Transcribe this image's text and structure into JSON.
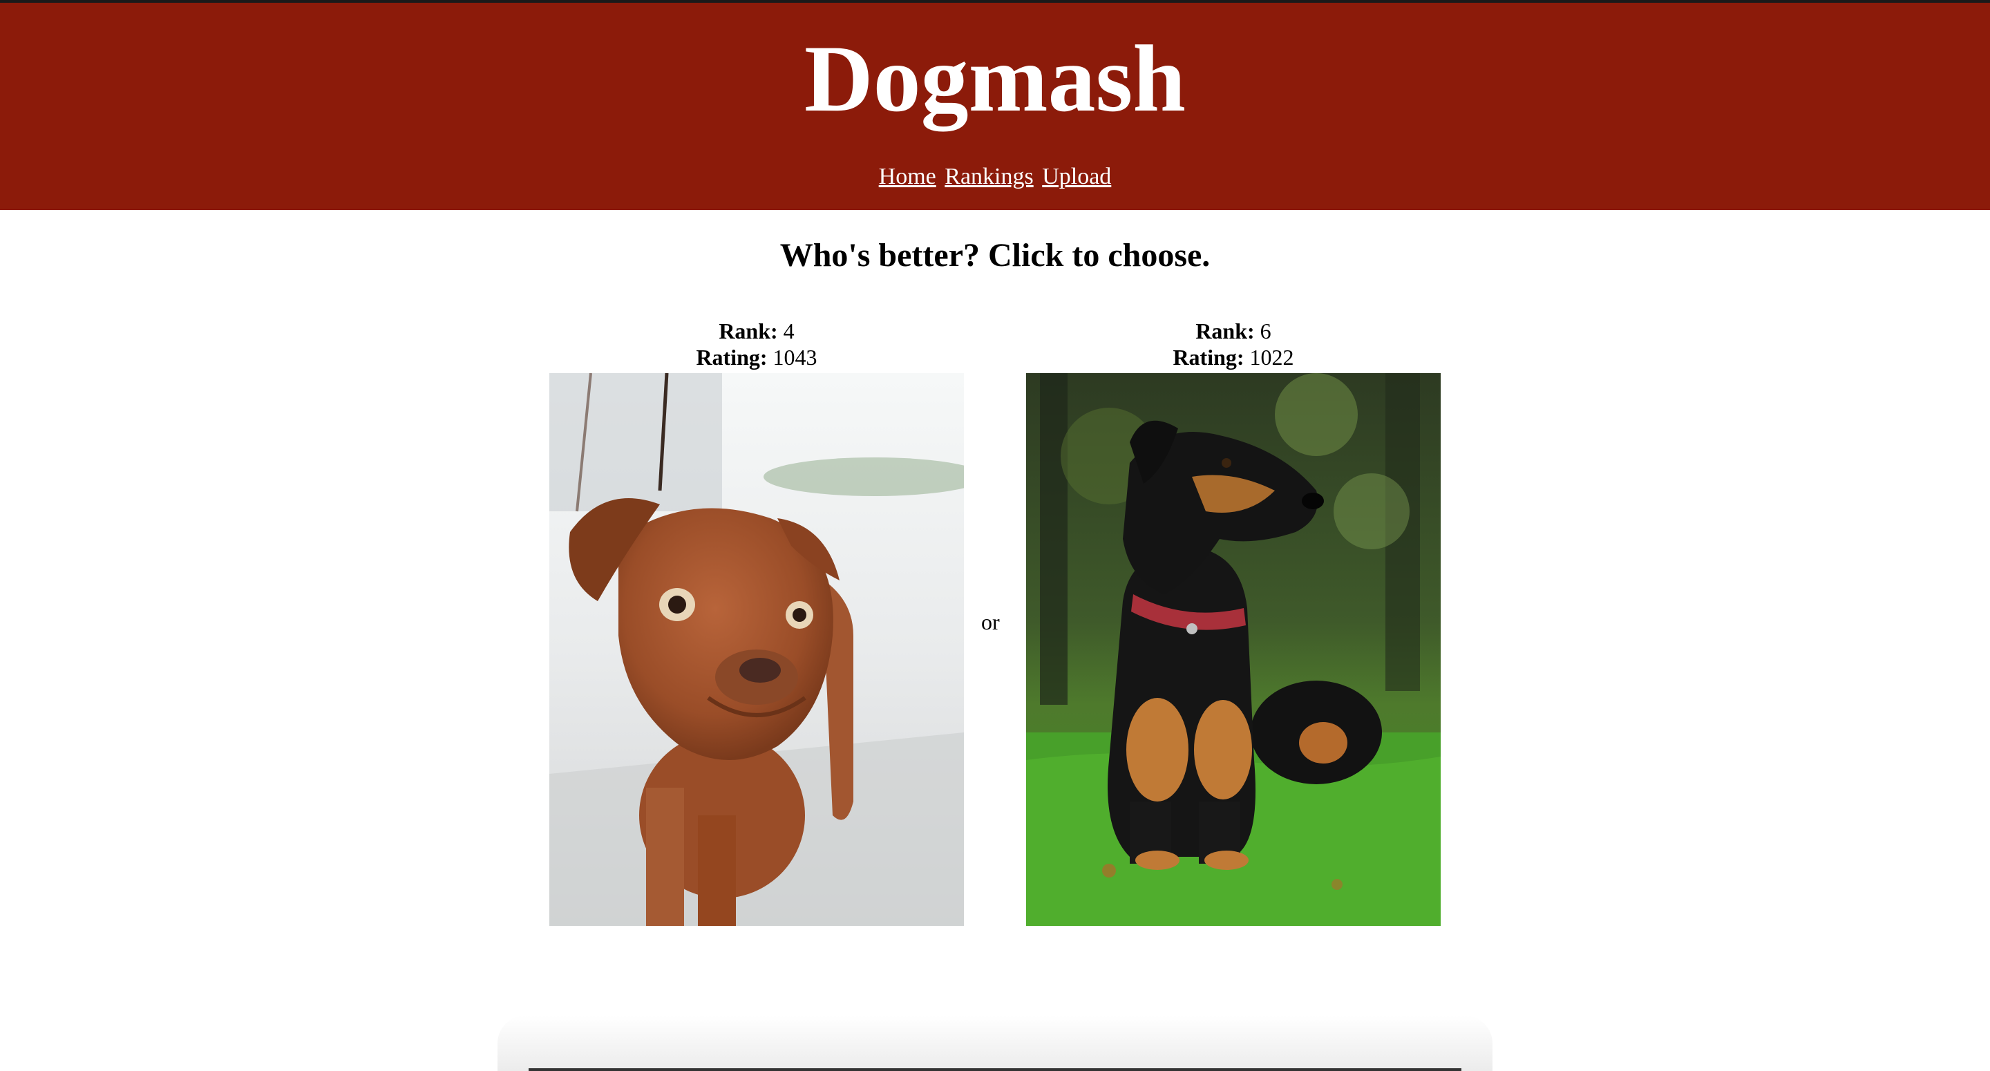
{
  "header": {
    "title": "Dogmash",
    "nav": [
      "Home",
      "Rankings",
      "Upload"
    ]
  },
  "main": {
    "prompt": "Who's better? Click to choose.",
    "separator": "or",
    "dogs": [
      {
        "rank_label": "Rank:",
        "rank": "4",
        "rating_label": "Rating:",
        "rating": "1043",
        "photo": "brown-dog-photo"
      },
      {
        "rank_label": "Rank:",
        "rank": "6",
        "rating_label": "Rating:",
        "rating": "1022",
        "photo": "black-tan-dog-photo"
      }
    ]
  },
  "colors": {
    "header_bg": "#8c1b0a",
    "header_text": "#ffffff"
  }
}
